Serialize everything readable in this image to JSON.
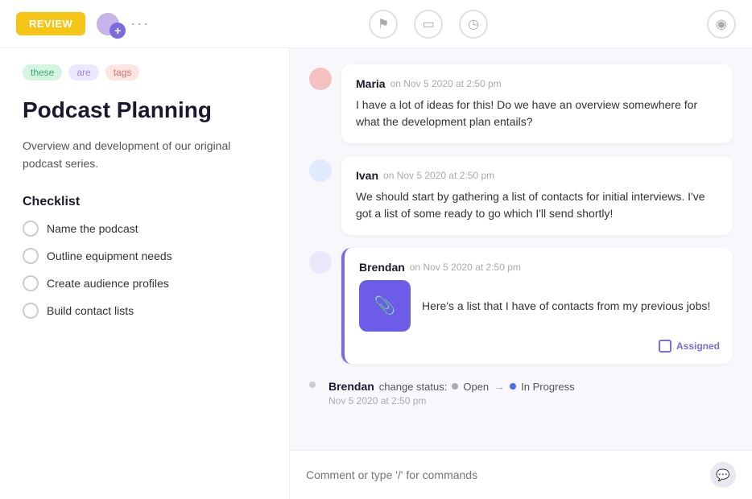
{
  "topBar": {
    "review_label": "REVIEW",
    "more_dots": "···",
    "flag_icon": "⚑",
    "card_icon": "▭",
    "clock_icon": "◷",
    "eye_icon": "◉"
  },
  "leftPanel": {
    "tags": [
      {
        "id": "tag-these",
        "label": "these",
        "color": "green"
      },
      {
        "id": "tag-are",
        "label": "are",
        "color": "purple"
      },
      {
        "id": "tag-tags",
        "label": "tags",
        "color": "red"
      }
    ],
    "title": "Podcast Planning",
    "description": "Overview and development of our original podcast series.",
    "checklist": {
      "title": "Checklist",
      "items": [
        {
          "id": "item-1",
          "label": "Name the podcast"
        },
        {
          "id": "item-2",
          "label": "Outline equipment needs"
        },
        {
          "id": "item-3",
          "label": "Create audience profiles"
        },
        {
          "id": "item-4",
          "label": "Build contact lists"
        }
      ]
    }
  },
  "rightPanel": {
    "comments": [
      {
        "id": "comment-maria",
        "author": "Maria",
        "timestamp": "on Nov 5 2020 at 2:50 pm",
        "text": "I have a lot of ideas for this! Do we have an overview somewhere for what the development plan entails?",
        "avatar_color": "#f5c0c0",
        "highlighted": false
      },
      {
        "id": "comment-ivan",
        "author": "Ivan",
        "timestamp": "on Nov 5 2020 at 2:50 pm",
        "text": "We should start by gathering a list of contacts for initial interviews. I've got a list of some ready to go which I'll send shortly!",
        "avatar_color": "#c0d5f5",
        "highlighted": false
      },
      {
        "id": "comment-brendan",
        "author": "Brendan",
        "timestamp": "on Nov 5 2020 at 2:50 pm",
        "text": "Here's a list that I have of contacts from my previous jobs!",
        "avatar_color": "#d5c8f5",
        "highlighted": true,
        "has_attachment": true,
        "assigned_label": "Assigned"
      }
    ],
    "statusChange": {
      "author": "Brendan",
      "action": "change status:",
      "from_label": "Open",
      "arrow": "→",
      "to_label": "In Progress",
      "timestamp": "Nov 5 2020 at 2:50 pm"
    },
    "commentInput": {
      "placeholder": "Comment or type '/' for commands"
    }
  }
}
